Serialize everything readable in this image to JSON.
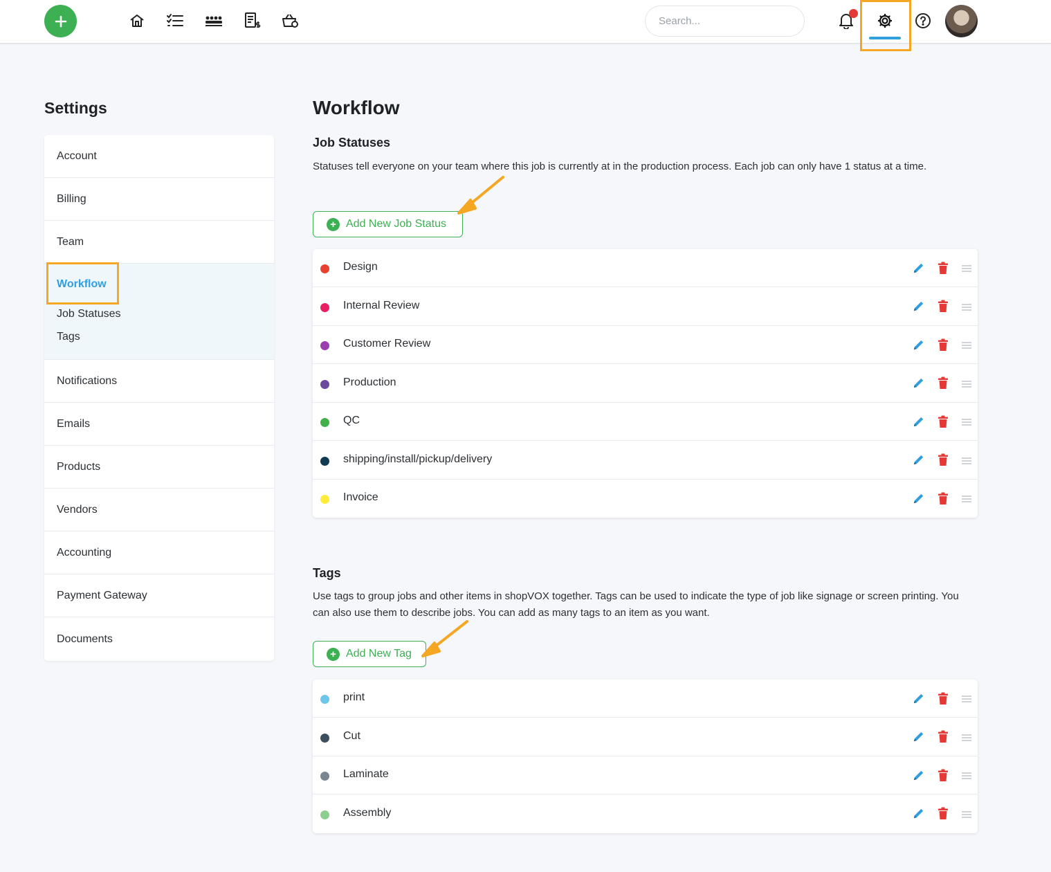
{
  "topbar": {
    "search_placeholder": "Search...",
    "icons": [
      "plus-icon",
      "home-icon",
      "list-icon",
      "team-icon",
      "invoice-icon",
      "shop-icon",
      "bell-icon",
      "gear-icon",
      "help-icon",
      "avatar"
    ]
  },
  "sidebar": {
    "title": "Settings",
    "items": [
      {
        "label": "Account"
      },
      {
        "label": "Billing"
      },
      {
        "label": "Team"
      },
      {
        "label": "Workflow",
        "active": true,
        "subitems": [
          "Job Statuses",
          "Tags"
        ]
      },
      {
        "label": "Notifications"
      },
      {
        "label": "Emails"
      },
      {
        "label": "Products"
      },
      {
        "label": "Vendors"
      },
      {
        "label": "Accounting"
      },
      {
        "label": "Payment Gateway"
      },
      {
        "label": "Documents"
      }
    ]
  },
  "main": {
    "title": "Workflow",
    "job_statuses": {
      "title": "Job Statuses",
      "description": "Statuses tell everyone on your team where this job is currently at in the production process. Each job can only have 1 status at a time.",
      "add_label": "Add New Job Status",
      "items": [
        {
          "label": "Design",
          "color": "#e8412f"
        },
        {
          "label": "Internal Review",
          "color": "#e91e63"
        },
        {
          "label": "Customer Review",
          "color": "#9c3fae"
        },
        {
          "label": "Production",
          "color": "#6a4a9e"
        },
        {
          "label": "QC",
          "color": "#43b04a"
        },
        {
          "label": "shipping/install/pickup/delivery",
          "color": "#0f3a52"
        },
        {
          "label": "Invoice",
          "color": "#ffeb3b"
        }
      ]
    },
    "tags": {
      "title": "Tags",
      "description": "Use tags to group jobs and other items in shopVOX together. Tags can be used to indicate the type of job like signage or screen printing. You can also use them to describe jobs. You can add as many tags to an item as you want.",
      "add_label": "Add New Tag",
      "items": [
        {
          "label": "print",
          "color": "#6ec6ea"
        },
        {
          "label": "Cut",
          "color": "#3d4f5c"
        },
        {
          "label": "Laminate",
          "color": "#7b8790"
        },
        {
          "label": "Assembly",
          "color": "#8ccf8f"
        }
      ]
    }
  },
  "colors": {
    "accent_green": "#3cb052",
    "accent_blue": "#2f9fe0",
    "highlight_orange": "#f5a623",
    "delete_red": "#e53935"
  }
}
